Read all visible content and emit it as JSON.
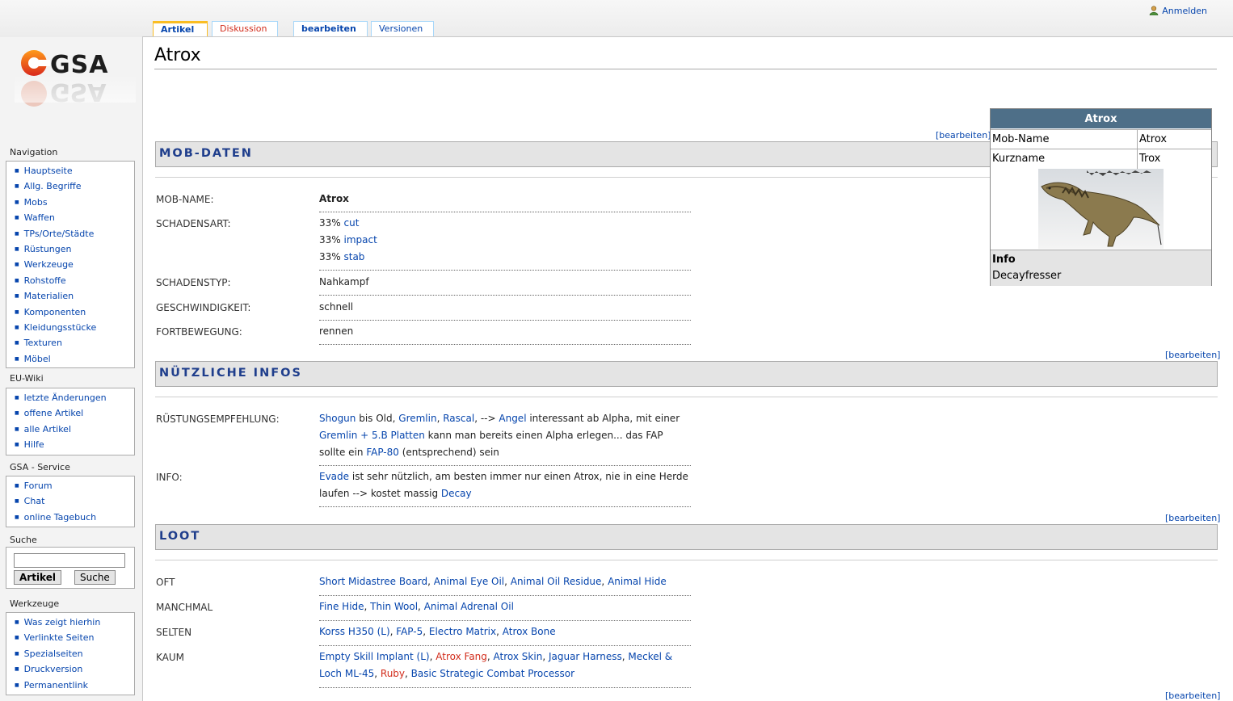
{
  "user": {
    "login_label": "Anmelden"
  },
  "tabs": {
    "article": "Artikel",
    "discussion": "Diskussion",
    "edit": "bearbeiten",
    "history": "Versionen"
  },
  "page": {
    "title": "Atrox"
  },
  "sidebar": {
    "navigation": {
      "heading": "Navigation",
      "items": [
        "Hauptseite",
        "Allg. Begriffe",
        "Mobs",
        "Waffen",
        "TPs/Orte/Städte",
        "Rüstungen",
        "Werkzeuge",
        "Rohstoffe",
        "Materialien",
        "Komponenten",
        "Kleidungsstücke",
        "Texturen",
        "Möbel"
      ]
    },
    "euwiki": {
      "heading": "EU-Wiki",
      "items": [
        "letzte Änderungen",
        "offene Artikel",
        "alle Artikel",
        "Hilfe"
      ]
    },
    "service": {
      "heading": "GSA - Service",
      "items": [
        "Forum",
        "Chat",
        "online Tagebuch"
      ]
    },
    "search": {
      "heading": "Suche",
      "btn_article": "Artikel",
      "btn_search": "Suche"
    },
    "tools": {
      "heading": "Werkzeuge",
      "items": [
        "Was zeigt hierhin",
        "Verlinkte Seiten",
        "Spezialseiten",
        "Druckversion",
        "Permanentlink"
      ]
    }
  },
  "edit_link": "[bearbeiten]",
  "sections": {
    "mob": {
      "title": "MOB-DATEN",
      "name_label": "MOB-NAME:",
      "name_value": "Atrox",
      "damage_label": "SCHADENSART:",
      "damage": [
        {
          "pct": "33% ",
          "type": "cut"
        },
        {
          "pct": "33% ",
          "type": "impact"
        },
        {
          "pct": "33% ",
          "type": "stab"
        }
      ],
      "dtype_label": "SCHADENSTYP:",
      "dtype_value": "Nahkampf",
      "speed_label": "GESCHWINDIGKEIT:",
      "speed_value": "schnell",
      "move_label": "FORTBEWEGUNG:",
      "move_value": "rennen"
    },
    "infos": {
      "title": "NÜTZLICHE INFOS",
      "armor_label": "RÜSTUNGSEMPFEHLUNG:",
      "armor": {
        "shogun": "Shogun",
        "t1": " bis Old, ",
        "gremlin": "Gremlin",
        "c1": ", ",
        "rascal": "Rascal",
        "t2": ", --> ",
        "angel": "Angel",
        "t3": " interessant ab Alpha, mit einer ",
        "gremlin_plates": "Gremlin + 5.B Platten",
        "t4": " kann man bereits einen Alpha erlegen... das FAP sollte ein ",
        "fap80": "FAP-80",
        "t5": " (entsprechend) sein"
      },
      "info_label": "INFO:",
      "info": {
        "evade": "Evade",
        "t1": " ist sehr nützlich, am besten immer nur einen Atrox, nie in eine Herde laufen --> kostet massig ",
        "decay": "Decay"
      }
    },
    "loot": {
      "title": "LOOT",
      "oft_label": "OFT",
      "oft": [
        "Short Midastree Board",
        "Animal Eye Oil",
        "Animal Oil Residue",
        "Animal Hide"
      ],
      "manchmal_label": "MANCHMAL",
      "manchmal": [
        "Fine Hide",
        "Thin Wool",
        "Animal Adrenal Oil"
      ],
      "selten_label": "SELTEN",
      "selten": [
        "Korss H350 (L)",
        "FAP-5",
        "Electro Matrix",
        "Atrox Bone"
      ],
      "kaum_label": "KAUM",
      "kaum": {
        "i1": "Empty Skill Implant (L)",
        "i2": "Atrox Fang",
        "i3": "Atrox Skin",
        "i4": "Jaguar Harness",
        "i5": "Meckel & Loch ML-45",
        "i6": "Ruby",
        "i7": "Basic Strategic Combat Processor",
        "sep": ", "
      }
    }
  },
  "infobox": {
    "title": "Atrox",
    "rows": [
      {
        "key": "Mob-Name",
        "value": "Atrox"
      },
      {
        "key": "Kurzname",
        "value": "Trox"
      }
    ],
    "info_heading": "Info",
    "info_value": "Decayfresser"
  },
  "colors": {
    "link": "#0645ad",
    "missing_link": "#d22c1b",
    "section_title": "#1f3e8c",
    "infobox_header": "#4e6f88"
  }
}
